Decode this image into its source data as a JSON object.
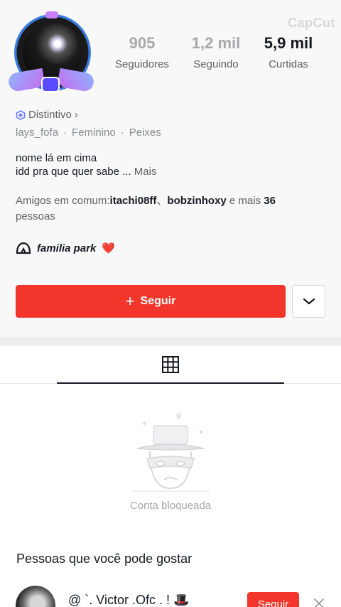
{
  "watermark": "CapCut",
  "stats": [
    {
      "value": "905",
      "label": "Seguidores"
    },
    {
      "value": "1,2 mil",
      "label": "Seguindo"
    },
    {
      "value": "5,9 mil",
      "label": "Curtidas"
    }
  ],
  "profile": {
    "badge_label": "Distintivo",
    "badge_chevron": "›",
    "username": "lays_fofa",
    "gender": "Feminino",
    "sign": "Peixes",
    "separator": "·",
    "bio_line1": "nome lá em cima",
    "bio_line2": "idd pra que quer sabe ...",
    "bio_more": "Mais",
    "friends_prefix": "Amigos em comum:",
    "friend1": "itachi08ff",
    "friend_sep": "、",
    "friend2": "bobzinhoxy",
    "friends_and_more": " e mais ",
    "friends_count": "36",
    "friends_suffix": "pessoas",
    "family_name": "familia park",
    "family_heart": "❤️"
  },
  "actions": {
    "follow_plus": "+",
    "follow_label": "Seguir"
  },
  "content": {
    "blocked_text": "Conta bloqueada"
  },
  "suggestions": {
    "title": "Pessoas que você pode gostar",
    "items": [
      {
        "name": "@ `. Victor .Ofc . ! 🎩",
        "follow_label": "Seguir"
      }
    ]
  },
  "colors": {
    "accent": "#f2362b",
    "badge": "#6b7cff"
  }
}
